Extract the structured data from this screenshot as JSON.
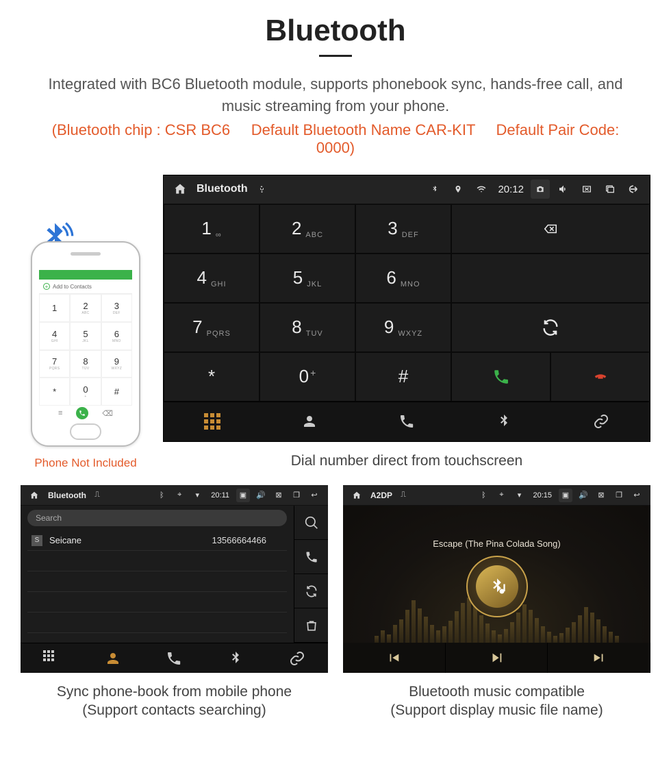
{
  "hero": {
    "title": "Bluetooth",
    "desc": "Integrated with BC6 Bluetooth module, supports phonebook sync, hands-free call, and music streaming from your phone.",
    "specs": "(Bluetooth chip : CSR BC6     Default Bluetooth Name CAR-KIT     Default Pair Code: 0000)"
  },
  "phone": {
    "add_to_contacts": "Add to Contacts",
    "keys": [
      {
        "n": "1",
        "s": ""
      },
      {
        "n": "2",
        "s": "ABC"
      },
      {
        "n": "3",
        "s": "DEF"
      },
      {
        "n": "4",
        "s": "GHI"
      },
      {
        "n": "5",
        "s": "JKL"
      },
      {
        "n": "6",
        "s": "MNO"
      },
      {
        "n": "7",
        "s": "PQRS"
      },
      {
        "n": "8",
        "s": "TUV"
      },
      {
        "n": "9",
        "s": "WXYZ"
      },
      {
        "n": "*",
        "s": ""
      },
      {
        "n": "0",
        "s": "+"
      },
      {
        "n": "#",
        "s": ""
      }
    ],
    "caption": "Phone Not Included"
  },
  "dialer": {
    "status": {
      "title": "Bluetooth",
      "time": "20:12"
    },
    "keys": [
      {
        "n": "1",
        "s": "∞"
      },
      {
        "n": "2",
        "s": "ABC"
      },
      {
        "n": "3",
        "s": "DEF"
      },
      {
        "n": "4",
        "s": "GHI"
      },
      {
        "n": "5",
        "s": "JKL"
      },
      {
        "n": "6",
        "s": "MNO"
      },
      {
        "n": "7",
        "s": "PQRS"
      },
      {
        "n": "8",
        "s": "TUV"
      },
      {
        "n": "9",
        "s": "WXYZ"
      },
      {
        "n": "*",
        "s": ""
      },
      {
        "n": "0",
        "s": "+"
      },
      {
        "n": "#",
        "s": ""
      }
    ],
    "caption": "Dial number direct from touchscreen"
  },
  "contacts": {
    "status": {
      "title": "Bluetooth",
      "time": "20:11"
    },
    "search_placeholder": "Search",
    "rows": [
      {
        "badge": "S",
        "name": "Seicane",
        "number": "13566664466"
      }
    ],
    "caption_l1": "Sync phone-book from mobile phone",
    "caption_l2": "(Support contacts searching)"
  },
  "music": {
    "status": {
      "title": "A2DP",
      "time": "20:15"
    },
    "track": "Escape (The Pina Colada Song)",
    "caption_l1": "Bluetooth music compatible",
    "caption_l2": "(Support display music file name)"
  }
}
